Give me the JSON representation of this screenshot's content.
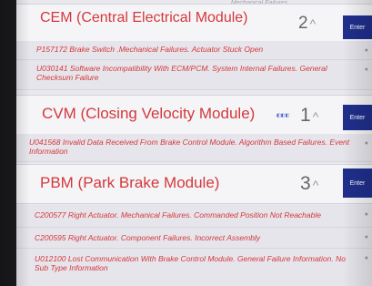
{
  "partial_text_top": "...Mechanical Failures",
  "modules": [
    {
      "title": "CEM (Central Electrical Module)",
      "count": "2",
      "enter_label": "Enter",
      "dtcs": [
        "P157172 Brake Switch .Mechanical Failures. Actuator Stuck Open",
        "U030141 Software Incompatibility With ECM/PCM. System Internal Failures. General Checksum Failure"
      ]
    },
    {
      "title": "CVM (Closing Velocity Module)",
      "count": "1",
      "enter_label": "Enter",
      "dtcs": [
        "U041568 Invalid Data Received From Brake Control Module. Algorithm Based Failures. Event Information"
      ]
    },
    {
      "title": "PBM (Park Brake Module)",
      "count": "3",
      "enter_label": "Enter",
      "dtcs": [
        "C200577 Right Actuator. Mechanical Failures. Commanded Position Not Reachable",
        "C200595 Right Actuator. Component Failures. Incorrect Assembly",
        "U012100 Lost Communication With Brake Control Module. General Failure Information. No Sub Type Information"
      ]
    }
  ],
  "icons": {
    "collapse": "chevron-up-icon",
    "info": "info-icon",
    "freeze": "freeze-frame-icon"
  },
  "colors": {
    "title_red": "#d4383a",
    "enter_blue": "#1f2f8c",
    "row_bg": "#e6e5eb"
  }
}
